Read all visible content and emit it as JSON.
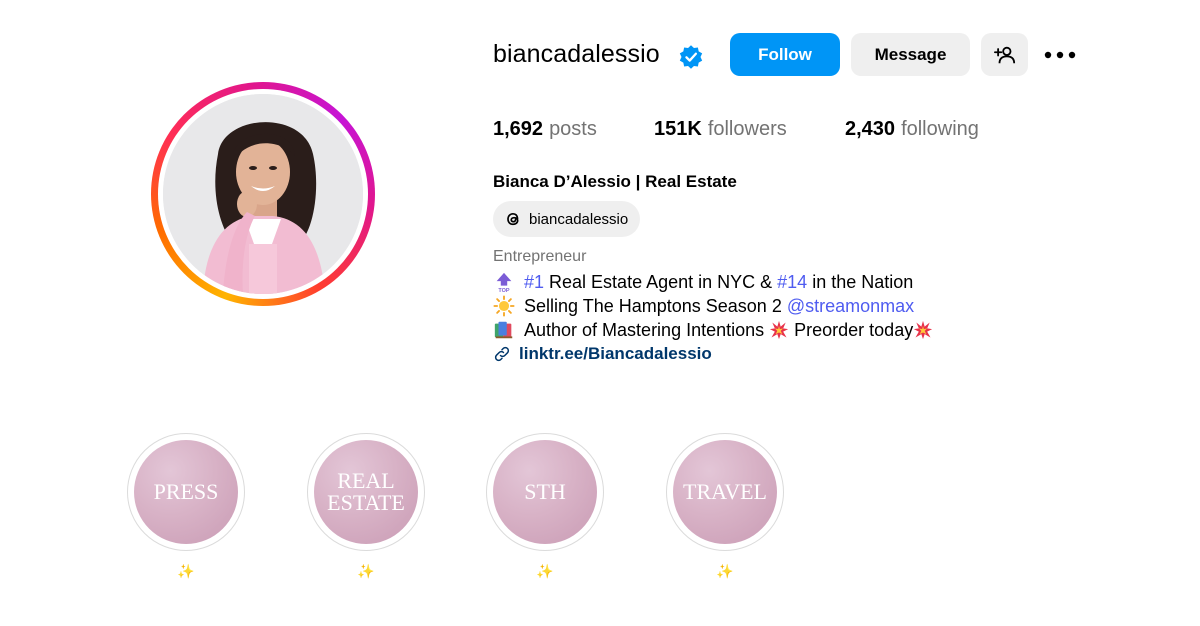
{
  "profile": {
    "username": "biancadalessio",
    "verified": true,
    "full_name": "Bianca D’Alessio | Real Estate",
    "threads_handle": "biancadalessio",
    "category": "Entrepreneur"
  },
  "actions": {
    "follow_label": "Follow",
    "message_label": "Message",
    "add_user_icon": "add-user-icon",
    "more_icon": "more-options-icon"
  },
  "stats": {
    "posts_count": "1,692",
    "posts_label": "posts",
    "followers_count": "151K",
    "followers_label": "followers",
    "following_count": "2,430",
    "following_label": "following"
  },
  "bio": {
    "line1": {
      "emoji": "top-arrow-icon",
      "rank1": "#1",
      "text1": "Real Estate Agent in NYC &",
      "rank2": "#14",
      "text2": "in the Nation"
    },
    "line2": {
      "emoji": "sun-icon",
      "text": "Selling The Hamptons Season 2",
      "mention": "@streamonmax"
    },
    "line3": {
      "emoji": "books-icon",
      "text1": "Author of Mastering Intentions",
      "text2": "Preorder today",
      "burst_emoji": "collision-icon"
    },
    "link": {
      "icon": "link-icon",
      "text": "linktr.ee/Biancadalessio"
    }
  },
  "highlights": [
    {
      "cover_text": [
        "PRESS"
      ],
      "title": "✨"
    },
    {
      "cover_text": [
        "REAL",
        "ESTATE"
      ],
      "title": "✨"
    },
    {
      "cover_text": [
        "STH"
      ],
      "title": "✨"
    },
    {
      "cover_text": [
        "TRAVEL"
      ],
      "title": "✨"
    }
  ],
  "colors": {
    "primary_button": "#0095f6",
    "secondary_button": "#efefef",
    "link_blue": "#4f5cf0",
    "link_dark": "#00376b",
    "muted_text": "#737373",
    "highlight_fill": "#d8b2c6"
  }
}
